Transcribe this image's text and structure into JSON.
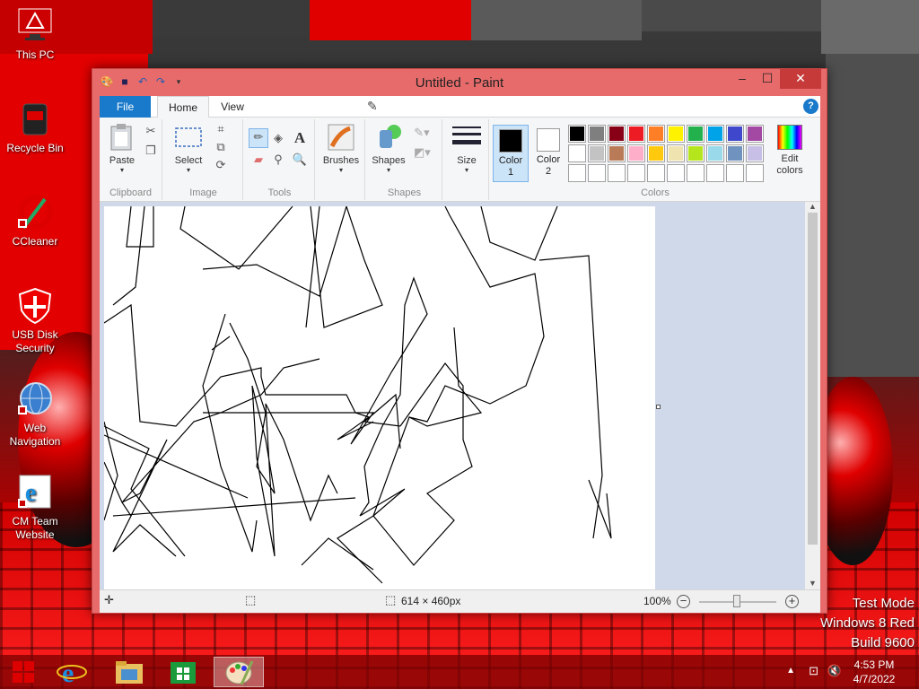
{
  "desktop": {
    "icons": [
      {
        "label": "This PC"
      },
      {
        "label": "Recycle Bin"
      },
      {
        "label": "CCleaner"
      },
      {
        "label": "USB Disk Security"
      },
      {
        "label": "Web Navigation"
      },
      {
        "label": "CM Team Website"
      }
    ],
    "watermark": {
      "line1": "Test Mode",
      "line2": "Windows 8 Red",
      "line3": "Build 9600"
    }
  },
  "window": {
    "title": "Untitled - Paint",
    "tabs": {
      "file": "File",
      "home": "Home",
      "view": "View"
    },
    "help": "?",
    "ribbon": {
      "clipboard": {
        "label": "Clipboard",
        "paste": "Paste"
      },
      "image": {
        "label": "Image",
        "select": "Select"
      },
      "tools": {
        "label": "Tools"
      },
      "brushes": {
        "label": "Brushes"
      },
      "shapes": {
        "label": "Shapes",
        "button": "Shapes"
      },
      "size": {
        "label": "Size"
      },
      "colors": {
        "label": "Colors",
        "color1": {
          "label": "Color",
          "num": "1"
        },
        "color2": {
          "label": "Color",
          "num": "2"
        },
        "edit_label": "Edit colors"
      },
      "text_tool": "A"
    },
    "status": {
      "dimensions": "614 × 460px",
      "zoom": "100%"
    }
  },
  "palette": {
    "row1": [
      "#000000",
      "#7f7f7f",
      "#880015",
      "#ed1c24",
      "#ff7f27",
      "#fff200",
      "#22b14c",
      "#00a2e8",
      "#3f48cc",
      "#a349a4"
    ],
    "row2": [
      "#ffffff",
      "#c3c3c3",
      "#b97a57",
      "#ffaec9",
      "#ffc90e",
      "#efe4b0",
      "#b5e61d",
      "#99d9ea",
      "#7092be",
      "#c8bfe7"
    ],
    "row3": [
      "",
      "",
      "",
      "",
      "",
      "",
      "",
      "",
      "",
      ""
    ]
  },
  "selected_colors": {
    "color1": "#000000",
    "color2": "#ffffff"
  },
  "taskbar": {
    "time": "4:53 PM",
    "date": "4/7/2022"
  }
}
